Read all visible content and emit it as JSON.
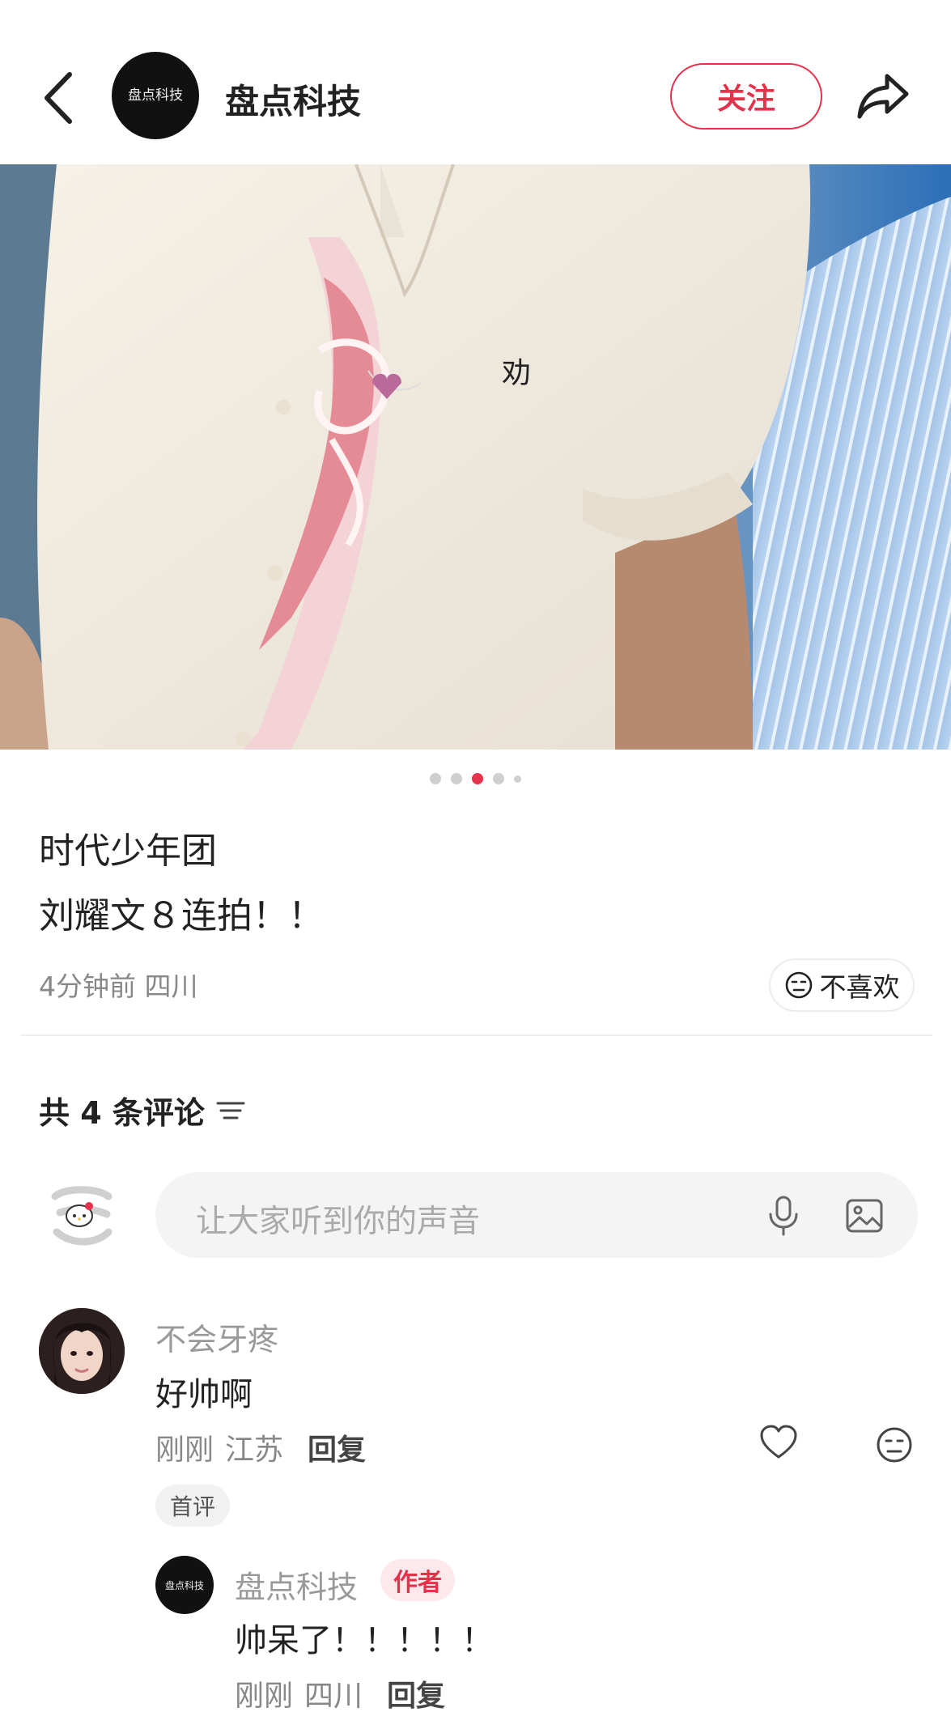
{
  "header": {
    "author_name": "盘点科技",
    "avatar_text": "盘点科技",
    "follow_label": "关注"
  },
  "carousel": {
    "total": 5,
    "active_index": 2
  },
  "post": {
    "line1": "时代少年团",
    "line2": "刘耀文８连拍！！",
    "time": "4分钟前",
    "location": "四川",
    "dislike_label": "不喜欢"
  },
  "comments_section": {
    "count_label": "共 4 条评论",
    "input_placeholder": "让大家听到你的声音"
  },
  "comments": [
    {
      "user": "不会牙疼",
      "text": "好帅啊",
      "time": "刚刚",
      "location": "江苏",
      "reply_label": "回复",
      "badge": "首评"
    }
  ],
  "replies": [
    {
      "user": "盘点科技",
      "badge": "作者",
      "text": "帅呆了！！！！！",
      "time": "刚刚",
      "location": "四川",
      "reply_label": "回复"
    }
  ],
  "colors": {
    "accent": "#e5324b"
  }
}
